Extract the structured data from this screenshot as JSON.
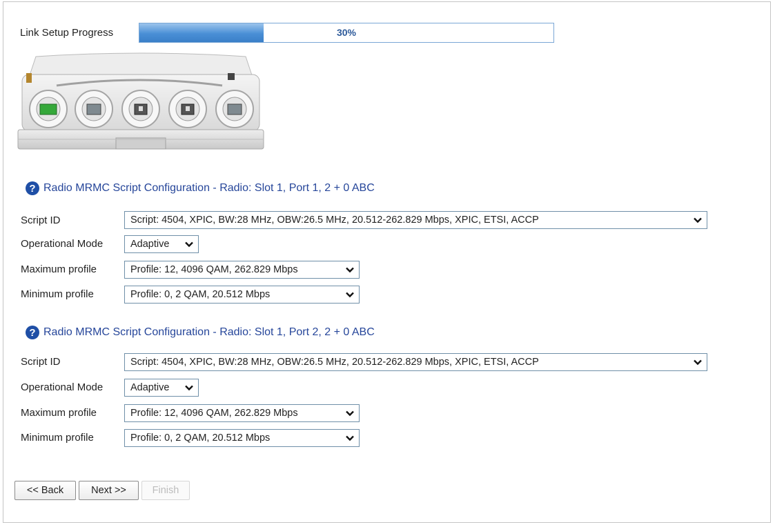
{
  "progress": {
    "label": "Link Setup Progress",
    "percent_text": "30%",
    "value": 0.3
  },
  "sections": [
    {
      "title": "Radio MRMC Script Configuration - Radio: Slot 1, Port 1, 2 + 0 ABC",
      "script_id_label": "Script ID",
      "script_id_value": "Script: 4504, XPIC, BW:28 MHz, OBW:26.5 MHz, 20.512-262.829 Mbps, XPIC, ETSI, ACCP",
      "mode_label": "Operational Mode",
      "mode_value": "Adaptive",
      "max_label": "Maximum profile",
      "max_value": "Profile: 12, 4096 QAM, 262.829 Mbps",
      "min_label": "Minimum profile",
      "min_value": "Profile: 0, 2 QAM, 20.512 Mbps"
    },
    {
      "title": "Radio MRMC Script Configuration - Radio: Slot 1, Port 2, 2 + 0 ABC",
      "script_id_label": "Script ID",
      "script_id_value": "Script: 4504, XPIC, BW:28 MHz, OBW:26.5 MHz, 20.512-262.829 Mbps, XPIC, ETSI, ACCP",
      "mode_label": "Operational Mode",
      "mode_value": "Adaptive",
      "max_label": "Maximum profile",
      "max_value": "Profile: 12, 4096 QAM, 262.829 Mbps",
      "min_label": "Minimum profile",
      "min_value": "Profile: 0, 2 QAM, 20.512 Mbps"
    }
  ],
  "buttons": {
    "back": "<< Back",
    "next": "Next >>",
    "finish": "Finish"
  },
  "colors": {
    "title_blue": "#26469a",
    "progress_fill": "#4a8fd6",
    "help_icon": "#1f4fa6"
  }
}
